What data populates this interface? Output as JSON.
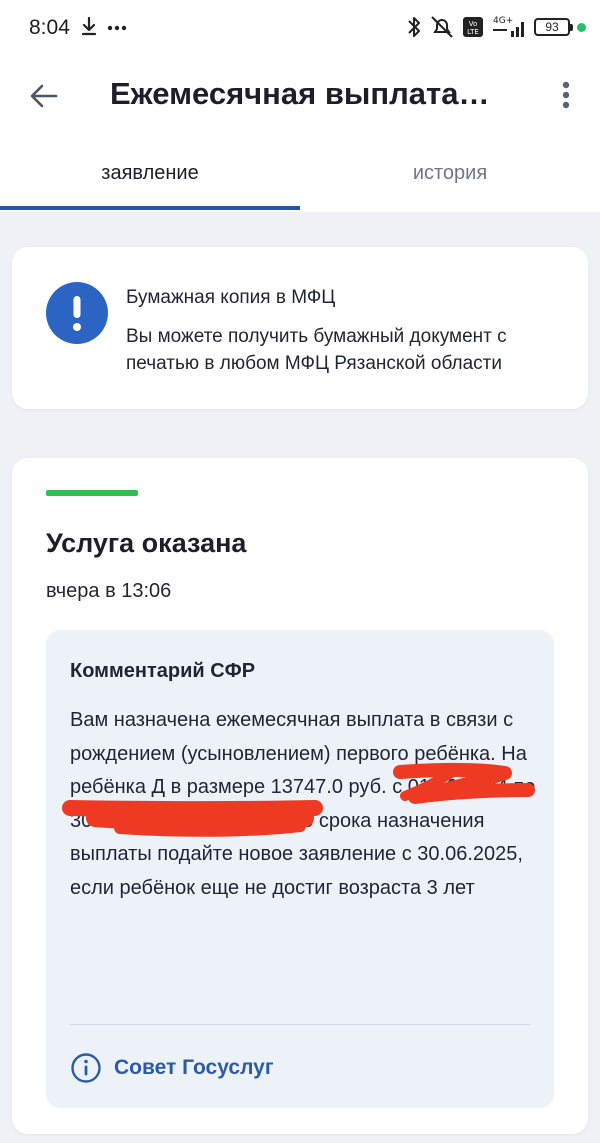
{
  "status_bar": {
    "time": "8:04",
    "battery": "93",
    "left_icons": [
      "download-icon",
      "more-dots-icon"
    ],
    "right_icons": [
      "bluetooth-icon",
      "mute-icon",
      "volte-icon",
      "signal-icon",
      "battery-icon",
      "dot-indicator"
    ],
    "indicator_color": "#27c165"
  },
  "app_bar": {
    "title": "Ежемесячная выплата…",
    "back_icon": "arrow-left-icon",
    "menu_icon": "more-vertical-icon"
  },
  "tabs": [
    {
      "label": "заявление",
      "active": true
    },
    {
      "label": "история",
      "active": false
    }
  ],
  "notice": {
    "icon": "exclamation-icon",
    "title": "Бумажная копия в МФЦ",
    "text": "Вы можете получить бумажный документ с печатью в любом МФЦ Рязанской области"
  },
  "status_card": {
    "status_color": "#2fbf52",
    "title": "Услуга оказана",
    "time": "вчера в 13:06",
    "comment": {
      "title": "Комментарий СФР",
      "text": "Вам назначена ежемесячная выплата в связи с рождением (усыновлением) первого ребёнка. На ребёнка Д                                   в размере 13747.0 руб. с 01.10.2024 по 30.06.2025. По окончанию срока назначения выплаты подайте новое заявление с 30.06.2025, если ребёнок еще не достиг возраста 3 лет"
    },
    "tip": {
      "icon": "info-icon",
      "label": "Совет Госуслуг"
    }
  },
  "colors": {
    "accent": "#2358a6",
    "link": "#2b5ba8",
    "alert": "#2c64c4",
    "background": "#eef1f6",
    "redaction": "#ee3a22"
  }
}
